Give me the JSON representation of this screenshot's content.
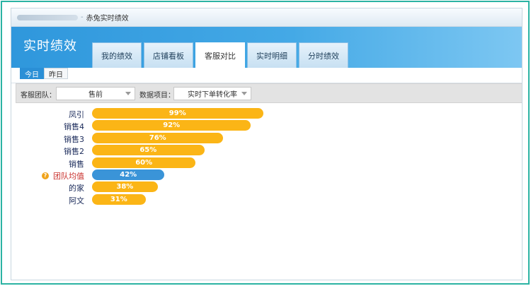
{
  "titlebar": {
    "title": "赤兔实时绩效"
  },
  "header": {
    "app_title": "实时绩效",
    "tabs": [
      {
        "label": "我的绩效"
      },
      {
        "label": "店铺看板"
      },
      {
        "label": "客服对比"
      },
      {
        "label": "实时明细"
      },
      {
        "label": "分时绩效"
      }
    ],
    "active_tab": "客服对比"
  },
  "day_toggle": {
    "today": "今日",
    "yesterday": "昨日",
    "active": "今日"
  },
  "filter": {
    "team_label": "客服团队：",
    "team_value": "售前",
    "metric_label": "数据项目：",
    "metric_value": "实时下单转化率"
  },
  "colors": {
    "bar": "#fbb516",
    "avg_bar": "#3a94d8",
    "header": "#3aa2e3",
    "highlight": "#c9302c"
  },
  "chart_data": {
    "type": "bar",
    "orientation": "horizontal",
    "unit": "%",
    "xlim": [
      0,
      100
    ],
    "items": [
      {
        "name": "凤引",
        "value": 99,
        "label": "99%"
      },
      {
        "name": "销售4",
        "value": 92,
        "label": "92%"
      },
      {
        "name": "销售3",
        "value": 76,
        "label": "76%"
      },
      {
        "name": "销售2",
        "value": 65,
        "label": "65%"
      },
      {
        "name": "销售",
        "value": 60,
        "label": "60%"
      },
      {
        "name": "团队均值",
        "value": 42,
        "label": "42%",
        "highlight": true
      },
      {
        "name": "的家",
        "value": 38,
        "label": "38%"
      },
      {
        "name": "阿文",
        "value": 31,
        "label": "31%"
      }
    ]
  }
}
